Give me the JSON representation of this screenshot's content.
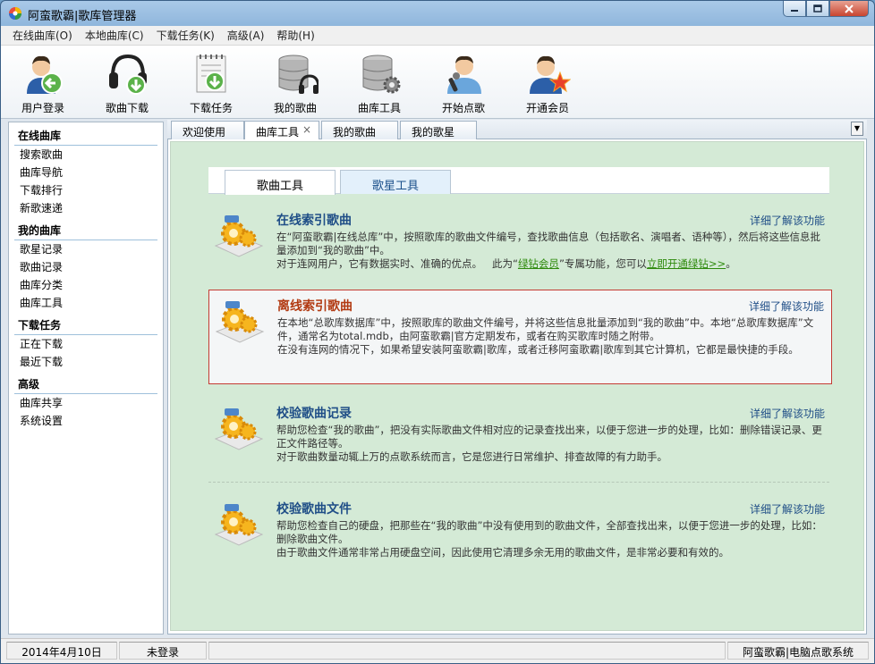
{
  "window": {
    "title": "阿蛮歌霸|歌库管理器",
    "minimize_icon": "minimize-icon",
    "maximize_icon": "maximize-icon",
    "close_icon": "close-icon"
  },
  "menu": [
    "在线曲库(O)",
    "本地曲库(C)",
    "下载任务(K)",
    "高级(A)",
    "帮助(H)"
  ],
  "toolbar": [
    {
      "label": "用户登录",
      "icon": "user-login-icon"
    },
    {
      "label": "歌曲下载",
      "icon": "song-download-icon"
    },
    {
      "label": "下载任务",
      "icon": "download-task-icon"
    },
    {
      "label": "我的歌曲",
      "icon": "my-songs-icon"
    },
    {
      "label": "曲库工具",
      "icon": "library-tools-icon"
    },
    {
      "label": "开始点歌",
      "icon": "start-singing-icon"
    },
    {
      "label": "开通会员",
      "icon": "vip-member-icon"
    }
  ],
  "sidebar": {
    "groups": [
      {
        "title": "在线曲库",
        "items": [
          "搜索歌曲",
          "曲库导航",
          "下载排行",
          "新歌速递"
        ]
      },
      {
        "title": "我的曲库",
        "items": [
          "歌星记录",
          "歌曲记录",
          "曲库分类",
          "曲库工具"
        ]
      },
      {
        "title": "下载任务",
        "items": [
          "正在下载",
          "最近下载"
        ]
      },
      {
        "title": "高级",
        "items": [
          "曲库共享",
          "系统设置"
        ]
      }
    ]
  },
  "tabs": [
    {
      "label": "欢迎使用",
      "active": false
    },
    {
      "label": "曲库工具",
      "active": true,
      "close": "×"
    },
    {
      "label": "我的歌曲",
      "active": false
    },
    {
      "label": "我的歌星",
      "active": false
    }
  ],
  "tabs_dropdown": "▼",
  "subtabs": [
    "歌曲工具",
    "歌星工具"
  ],
  "features": [
    {
      "title": "在线索引歌曲",
      "link": "详细了解该功能",
      "lines": [
        "在“阿蛮歌霸|在线总库”中，按照歌库的歌曲文件编号，查找歌曲信息（包括歌名、演唱者、语种等），然后将这些信息批量添加到“我的歌曲”中。",
        "对于连网用户，它有数据实时、准确的优点。"
      ],
      "line2_mid": "此为“",
      "line2_green1": "绿钻会员",
      "line2_mid2": "”专属功能，您可以",
      "line2_green2": "立即开通绿钻>>",
      "line2_end": "。"
    },
    {
      "title": "离线索引歌曲",
      "link": "详细了解该功能",
      "lines": [
        "在本地“总歌库数据库”中，按照歌库的歌曲文件编号，并将这些信息批量添加到“我的歌曲”中。本地“总歌库数据库”文件，通常名为total.mdb，由阿蛮歌霸|官方定期发布，或者在购买歌库时随之附带。",
        "在没有连网的情况下，如果希望安装阿蛮歌霸|歌库，或者迁移阿蛮歌霸|歌库到其它计算机，它都是最快捷的手段。"
      ]
    },
    {
      "title": "校验歌曲记录",
      "link": "详细了解该功能",
      "lines": [
        "帮助您检查“我的歌曲”，把没有实际歌曲文件相对应的记录查找出来，以便于您进一步的处理，比如：删除错误记录、更正文件路径等。",
        "对于歌曲数量动辄上万的点歌系统而言，它是您进行日常维护、排查故障的有力助手。"
      ]
    },
    {
      "title": "校验歌曲文件",
      "link": "详细了解该功能",
      "lines": [
        "帮助您检查自己的硬盘，把那些在“我的歌曲”中没有使用到的歌曲文件，全部查找出来，以便于您进一步的处理，比如：删除歌曲文件。",
        "由于歌曲文件通常非常占用硬盘空间，因此使用它清理多余无用的歌曲文件，是非常必要和有效的。"
      ]
    }
  ],
  "status": {
    "date": "2014年4月10日",
    "login": "未登录",
    "brand": "阿蛮歌霸|电脑点歌系统"
  }
}
